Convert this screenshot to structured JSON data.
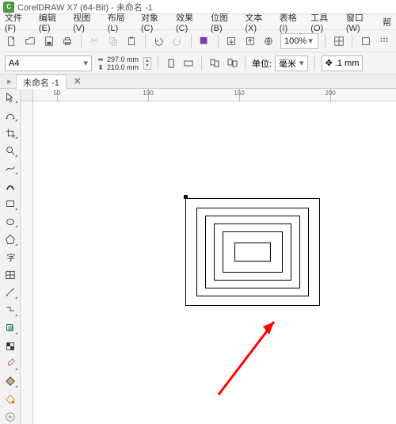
{
  "title": "CorelDRAW X7 (64-Bit) - 未命名 -1",
  "menu": {
    "file": "文件(F)",
    "edit": "编辑(E)",
    "view": "视图(V)",
    "layout": "布局(L)",
    "object": "对象(C)",
    "effects": "效果(C)",
    "bitmap": "位图(B)",
    "text": "文本(X)",
    "table": "表格(I)",
    "tools": "工具(O)",
    "window": "窗口(W)",
    "help": "帮"
  },
  "zoom": "100%",
  "page_size": "A4",
  "page_w": "297.0 mm",
  "page_h": "210.0 mm",
  "unit_label": "单位:",
  "unit_value": "毫米",
  "nudge": ".1 mm",
  "tab_name": "未命名 -1",
  "ruler_ticks": [
    "50",
    "100",
    "150",
    "200"
  ]
}
